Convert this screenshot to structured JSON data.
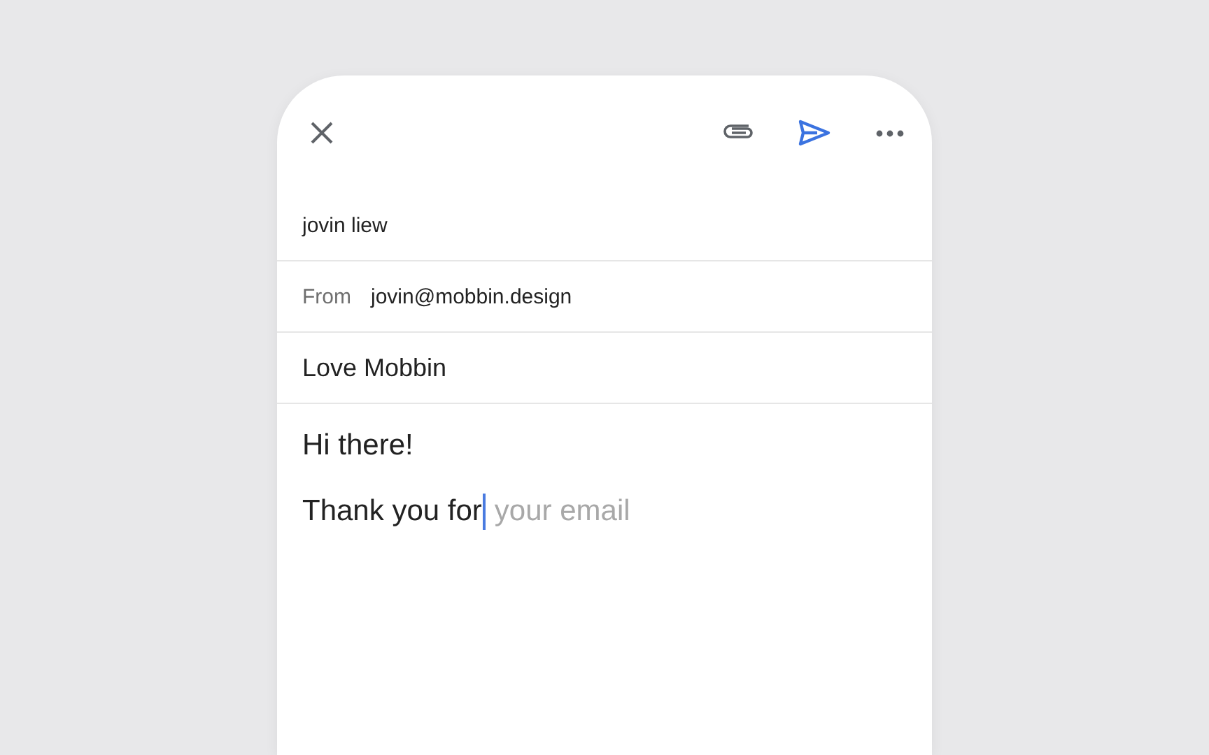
{
  "toolbar": {
    "actions": [
      {
        "kind": "close"
      },
      {
        "kind": "attach"
      },
      {
        "kind": "send"
      },
      {
        "kind": "more"
      }
    ]
  },
  "to": {
    "value": "jovin liew"
  },
  "from": {
    "label": "From",
    "value": "jovin@mobbin.design"
  },
  "subject": {
    "value": "Love Mobbin"
  },
  "body": {
    "greeting": "Hi there!",
    "typed": "Thank you for",
    "suggestion": "your email",
    "cursor": true
  }
}
